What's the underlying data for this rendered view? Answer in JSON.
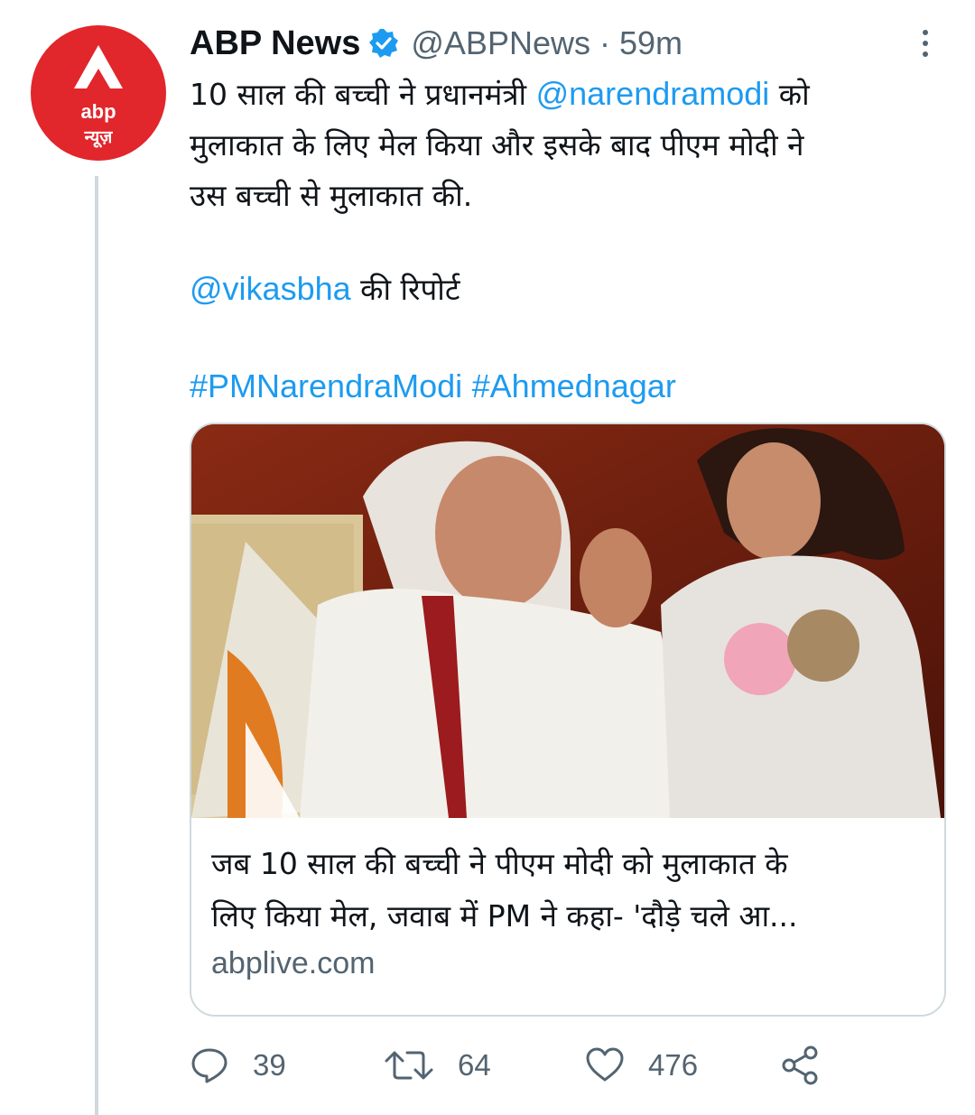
{
  "avatar": {
    "line1": "abp",
    "line2": "न्यूज़"
  },
  "header": {
    "name": "ABP News",
    "handle": "@ABPNews · 59m"
  },
  "tweet": {
    "l1a": "10 साल की बच्ची ने प्रधानमंत्री ",
    "l1m": "@narendramodi",
    "l1b": " को",
    "l2": "मुलाकात के लिए मेल किया और इसके बाद पीएम मोदी ने",
    "l3": "उस बच्ची से मुलाकात की.",
    "reporter": "@vikasbha",
    "reporter_suffix": " की रिपोर्ट",
    "tag1": "#PMNarendraModi",
    "tag2": "#Ahmednagar"
  },
  "card": {
    "title_l1": "जब 10 साल की बच्ची ने पीएम मोदी को मुलाकात के",
    "title_l2": "लिए किया मेल, जवाब में PM ने कहा- 'दौड़े चले आ...",
    "domain": "abplive.com"
  },
  "actions": {
    "replies": "39",
    "retweets": "64",
    "likes": "476"
  },
  "colors": {
    "link": "#1d9bf0",
    "secondary": "#536471",
    "avatar_red": "#e1262c"
  }
}
